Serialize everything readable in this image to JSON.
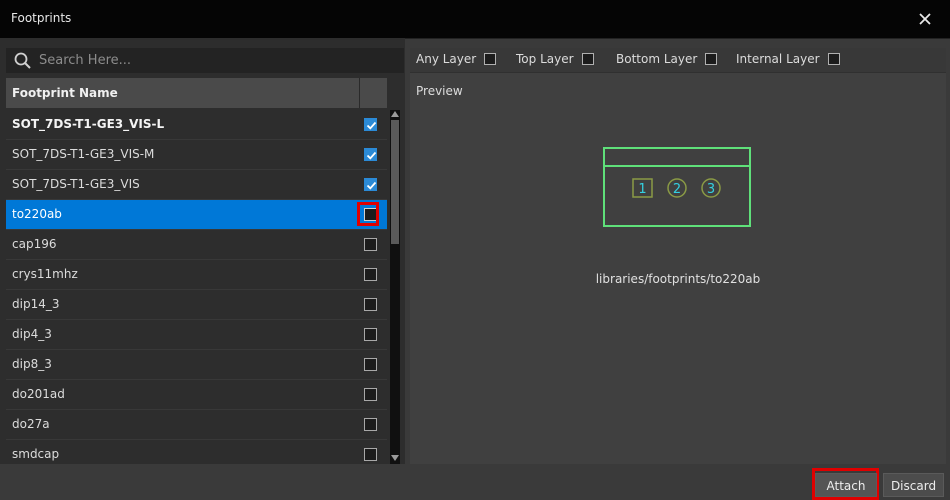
{
  "window": {
    "title": "Footprints"
  },
  "search": {
    "placeholder": "Search Here..."
  },
  "table": {
    "column_header": "Footprint Name",
    "rows": [
      {
        "name": "SOT_7DS-T1-GE3_VIS-L",
        "checked": true,
        "bold": true,
        "selected": false
      },
      {
        "name": "SOT_7DS-T1-GE3_VIS-M",
        "checked": true,
        "bold": false,
        "selected": false
      },
      {
        "name": "SOT_7DS-T1-GE3_VIS",
        "checked": true,
        "bold": false,
        "selected": false
      },
      {
        "name": "to220ab",
        "checked": false,
        "bold": false,
        "selected": true
      },
      {
        "name": "cap196",
        "checked": false,
        "bold": false,
        "selected": false
      },
      {
        "name": "crys11mhz",
        "checked": false,
        "bold": false,
        "selected": false
      },
      {
        "name": "dip14_3",
        "checked": false,
        "bold": false,
        "selected": false
      },
      {
        "name": "dip4_3",
        "checked": false,
        "bold": false,
        "selected": false
      },
      {
        "name": "dip8_3",
        "checked": false,
        "bold": false,
        "selected": false
      },
      {
        "name": "do201ad",
        "checked": false,
        "bold": false,
        "selected": false
      },
      {
        "name": "do27a",
        "checked": false,
        "bold": false,
        "selected": false
      },
      {
        "name": "smdcap",
        "checked": false,
        "bold": false,
        "selected": false
      }
    ]
  },
  "layers": {
    "any": "Any Layer",
    "top": "Top Layer",
    "bottom": "Bottom Layer",
    "internal": "Internal Layer"
  },
  "preview": {
    "label": "Preview",
    "pads": [
      "1",
      "2",
      "3"
    ],
    "path": "libraries/footprints/to220ab"
  },
  "actions": {
    "attach": "Attach",
    "discard": "Discard"
  },
  "colors": {
    "selection": "#0078d7",
    "highlight": "#e00000",
    "outline": "#5fe07a",
    "pad": "#34d0e0"
  }
}
